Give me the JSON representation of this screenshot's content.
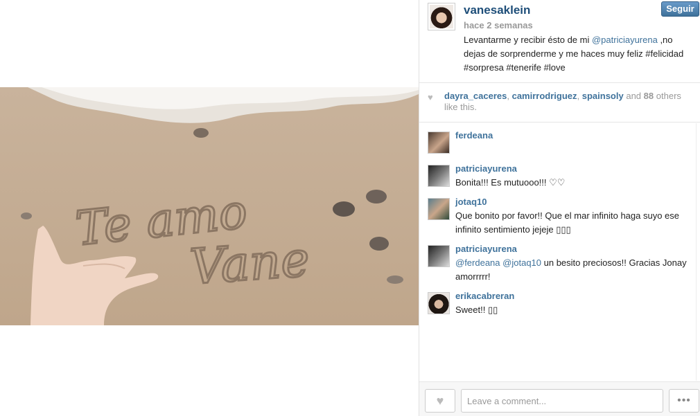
{
  "post": {
    "username": "vanesaklein",
    "time_ago": "hace 2 semanas",
    "follow_label": "Seguir",
    "caption_before": "Levantarme y recibir ésto de mi ",
    "caption_mention": "@patriciayurena",
    "caption_after": " ,no dejas de sorprenderme y me haces muy feliz #felicidad #sorpresa #tenerife #love"
  },
  "likes": {
    "likers": [
      "dayra_caceres",
      "camirrodriguez",
      "spainsoly"
    ],
    "and_text": "and",
    "others_count": "88",
    "others_text": "others like this."
  },
  "photo": {
    "sand_text_line1": "Te amo",
    "sand_text_line2": "Vane"
  },
  "comments": [
    {
      "user": "ferdeana",
      "text": ""
    },
    {
      "user": "patriciayurena",
      "text": "Bonita!!! Es mutuooo!!! ♡♡"
    },
    {
      "user": "jotaq10",
      "text": "Que bonito por favor!! Que el mar infinito haga suyo ese infinito sentimiento jejeje ▯▯▯"
    },
    {
      "user": "patriciayurena",
      "mention1": "@ferdeana",
      "mention2": "@jotaq10",
      "text": " un besito preciosos!! Gracias Jonay amorrrrr!"
    },
    {
      "user": "erikacabreran",
      "text": "Sweet!! ▯▯"
    }
  ],
  "footer": {
    "comment_placeholder": "Leave a comment...",
    "more_label": "•••"
  },
  "icons": {
    "like": "heart-icon",
    "more": "ellipsis-icon"
  }
}
